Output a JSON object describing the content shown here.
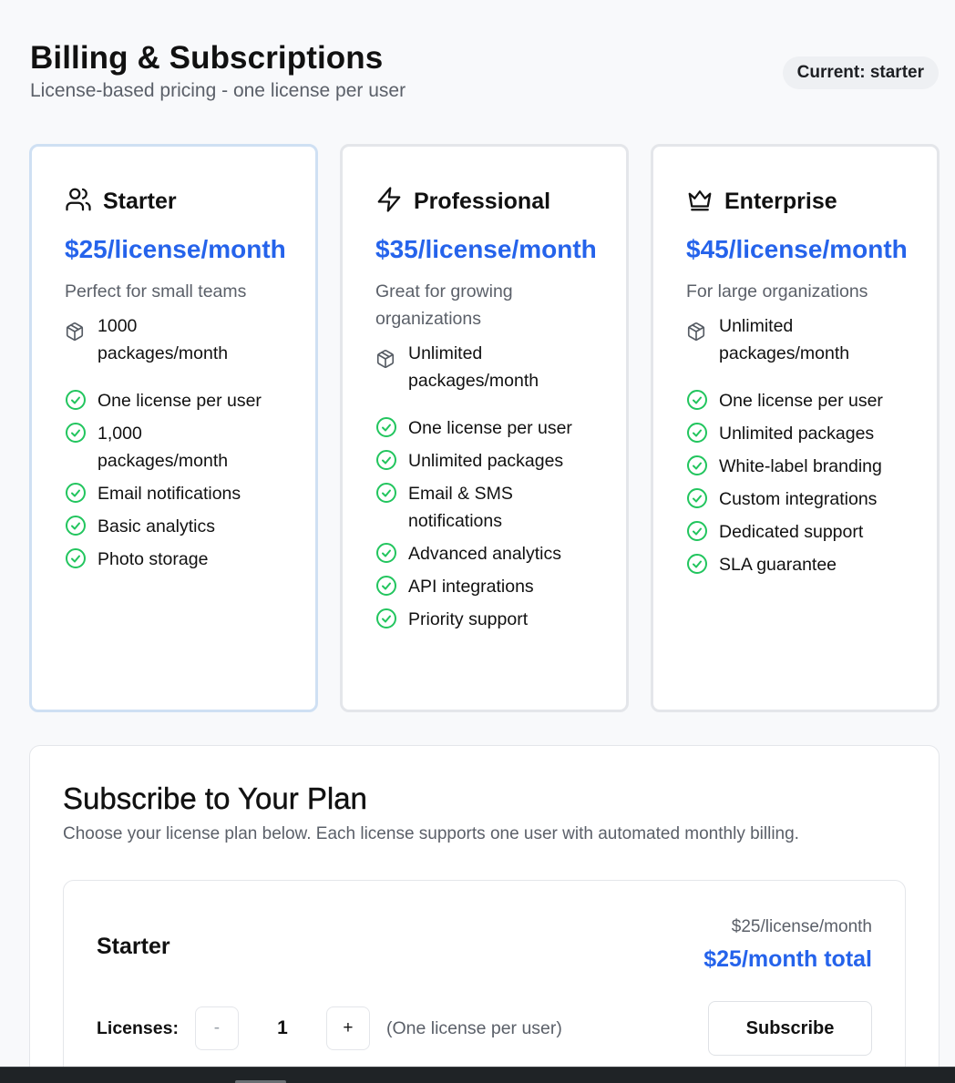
{
  "header": {
    "title": "Billing & Subscriptions",
    "subtitle": "License-based pricing - one license per user",
    "current_badge": "Current: starter"
  },
  "plans": [
    {
      "icon": "users-icon",
      "name": "Starter",
      "price": "$25/license/month",
      "description": "Perfect for small teams",
      "packages": "1000 packages/month",
      "features": [
        "One license per user",
        "1,000 packages/month",
        "Email notifications",
        "Basic analytics",
        "Photo storage"
      ]
    },
    {
      "icon": "lightning-icon",
      "name": "Professional",
      "price": "$35/license/month",
      "description": "Great for growing organizations",
      "packages": "Unlimited packages/month",
      "features": [
        "One license per user",
        "Unlimited packages",
        "Email & SMS notifications",
        "Advanced analytics",
        "API integrations",
        "Priority support"
      ]
    },
    {
      "icon": "crown-icon",
      "name": "Enterprise",
      "price": "$45/license/month",
      "description": "For large organizations",
      "packages": "Unlimited packages/month",
      "features": [
        "One license per user",
        "Unlimited packages",
        "White-label branding",
        "Custom integrations",
        "Dedicated support",
        "SLA guarantee"
      ]
    }
  ],
  "subscribe": {
    "title": "Subscribe to Your Plan",
    "description": "Choose your license plan below. Each license supports one user with automated monthly billing.",
    "selected_plan": {
      "name": "Starter",
      "unit_price": "$25/license/month",
      "total": "$25/month total",
      "licenses_label": "Licenses:",
      "decrement_label": "-",
      "quantity": "1",
      "increment_label": "+",
      "note": "(One license per user)",
      "subscribe_label": "Subscribe"
    }
  },
  "colors": {
    "accent": "#2563eb",
    "check": "#22c55e",
    "current_border": "#cfe0f3"
  }
}
